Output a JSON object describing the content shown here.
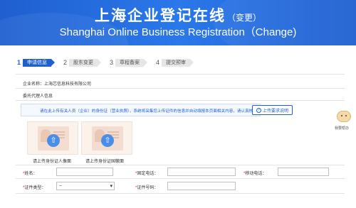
{
  "header": {
    "title_cn": "上海企业登记在线",
    "title_cn_suffix": "（变更）",
    "title_en": "Shanghai Online Business Registration（Change)"
  },
  "steps": [
    {
      "num": "1",
      "label": "申请信息",
      "active": true
    },
    {
      "num": "2",
      "label": "股东变更",
      "active": false
    },
    {
      "num": "3",
      "label": "章程备案",
      "active": false
    },
    {
      "num": "4",
      "label": "提交预审",
      "active": false
    }
  ],
  "company": {
    "label": "企业名称：",
    "value": "上海芯信息科技有限公司"
  },
  "section_title": "委托代理人信息",
  "notice": {
    "text": "请在此上传有关人员（企业）的身份证（营业执照），系统将采集您上传证件的信息并自动填报本页面相关内容，请认真核对。",
    "button_label": "上传要求说明",
    "icon": "question-icon"
  },
  "uploads": [
    {
      "label": "请上传身份证人像面",
      "icon": "upload-arrow-icon"
    },
    {
      "label": "请上传身份证国徽面",
      "icon": "upload-arrow-icon"
    }
  ],
  "form": {
    "name_label": "姓名：",
    "phone_label": "固定电话：",
    "mobile_label": "移动电话：",
    "id_type_label": "证件类型：",
    "id_type_value": "--",
    "id_number_label": "证件号码：",
    "required_mark": "*"
  },
  "assistant": {
    "label": "我要帮办",
    "icon": "assistant-mascot-icon"
  },
  "colors": {
    "primary": "#1f5fd0",
    "required": "#e02020"
  }
}
